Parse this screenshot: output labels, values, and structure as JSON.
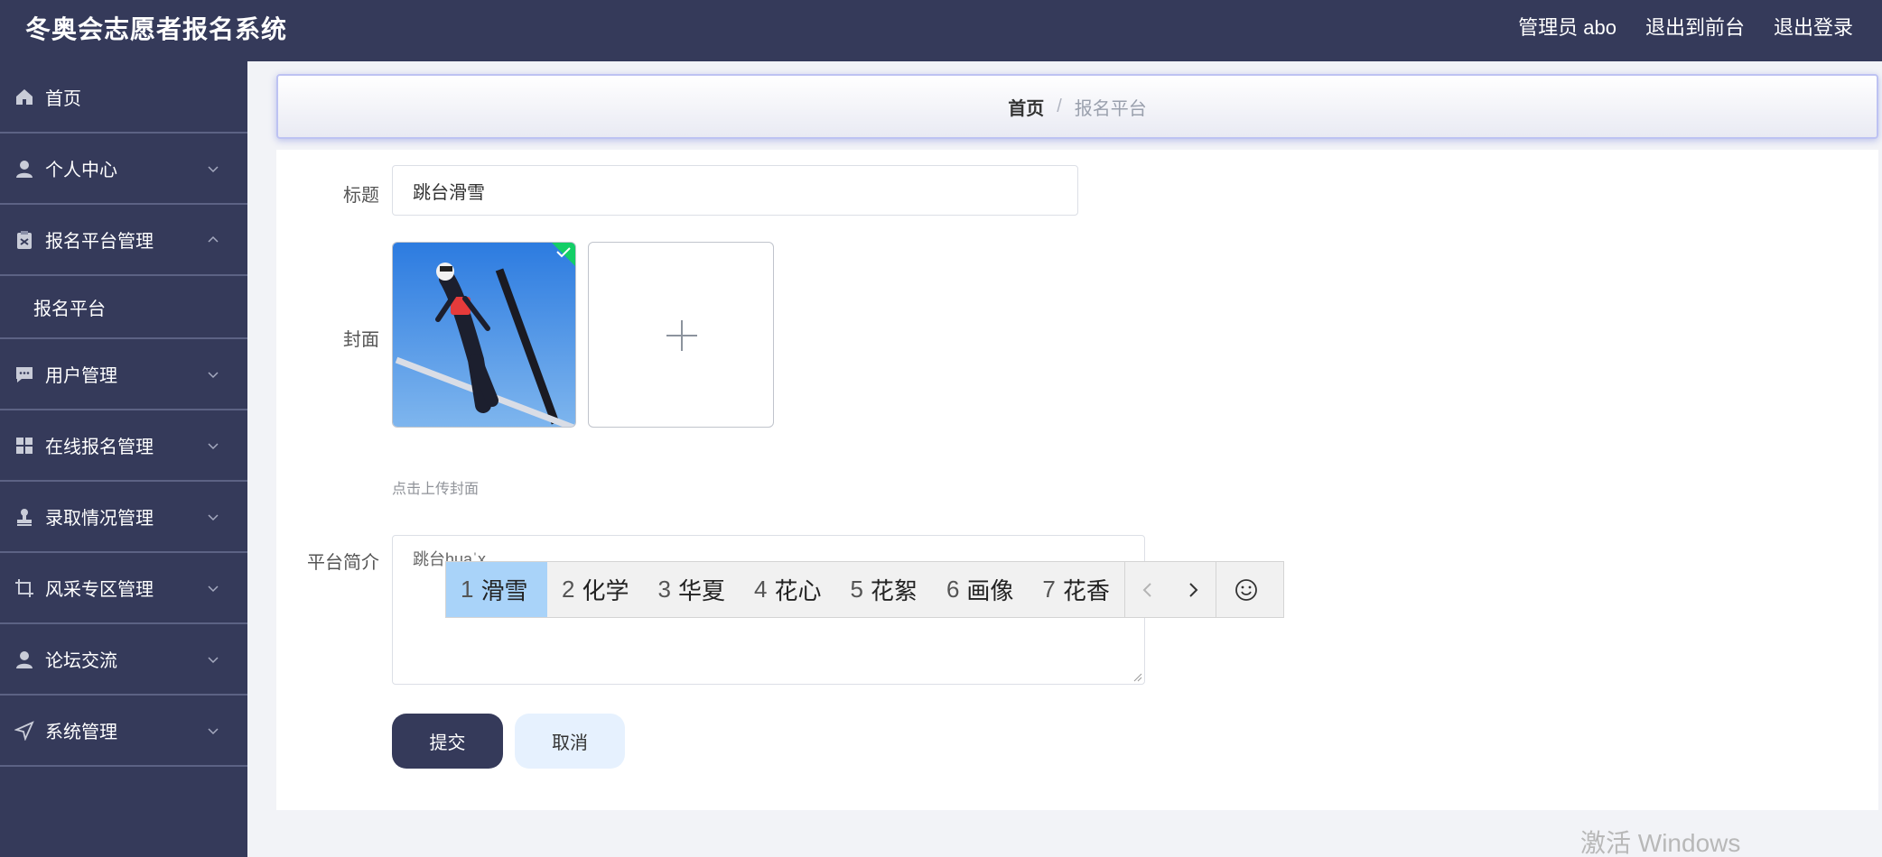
{
  "header": {
    "app_title": "冬奥会志愿者报名系统",
    "admin_label": "管理员 abo",
    "to_front_label": "退出到前台",
    "logout_label": "退出登录"
  },
  "sidebar": {
    "items": [
      {
        "label": "首页",
        "icon": "home-icon"
      },
      {
        "label": "个人中心",
        "icon": "user-icon"
      },
      {
        "label": "报名平台管理",
        "icon": "clipboard-icon",
        "expanded": true
      },
      {
        "label": "用户管理",
        "icon": "chat-icon"
      },
      {
        "label": "在线报名管理",
        "icon": "grid-icon"
      },
      {
        "label": "录取情况管理",
        "icon": "stamp-icon"
      },
      {
        "label": "风采专区管理",
        "icon": "crop-icon"
      },
      {
        "label": "论坛交流",
        "icon": "user-icon"
      },
      {
        "label": "系统管理",
        "icon": "send-icon"
      }
    ],
    "sub_item": "报名平台"
  },
  "breadcrumb": {
    "home": "首页",
    "separator": "/",
    "current": "报名平台"
  },
  "form": {
    "title_label": "标题",
    "title_value": "跳台滑雪",
    "cover_label": "封面",
    "upload_tip": "点击上传封面",
    "intro_label": "平台简介",
    "intro_value": "跳台huaˈx",
    "submit_label": "提交",
    "cancel_label": "取消"
  },
  "ime": {
    "candidates": [
      {
        "num": "1",
        "text": "滑雪"
      },
      {
        "num": "2",
        "text": "化学"
      },
      {
        "num": "3",
        "text": "华夏"
      },
      {
        "num": "4",
        "text": "花心"
      },
      {
        "num": "5",
        "text": "花絮"
      },
      {
        "num": "6",
        "text": "画像"
      },
      {
        "num": "7",
        "text": "花香"
      }
    ]
  },
  "watermark": "激活 Windows",
  "colors": {
    "sidebar_bg": "#353a5a",
    "ime_selected": "#a9d3f9",
    "cancel_bg": "#e6f1fe"
  }
}
